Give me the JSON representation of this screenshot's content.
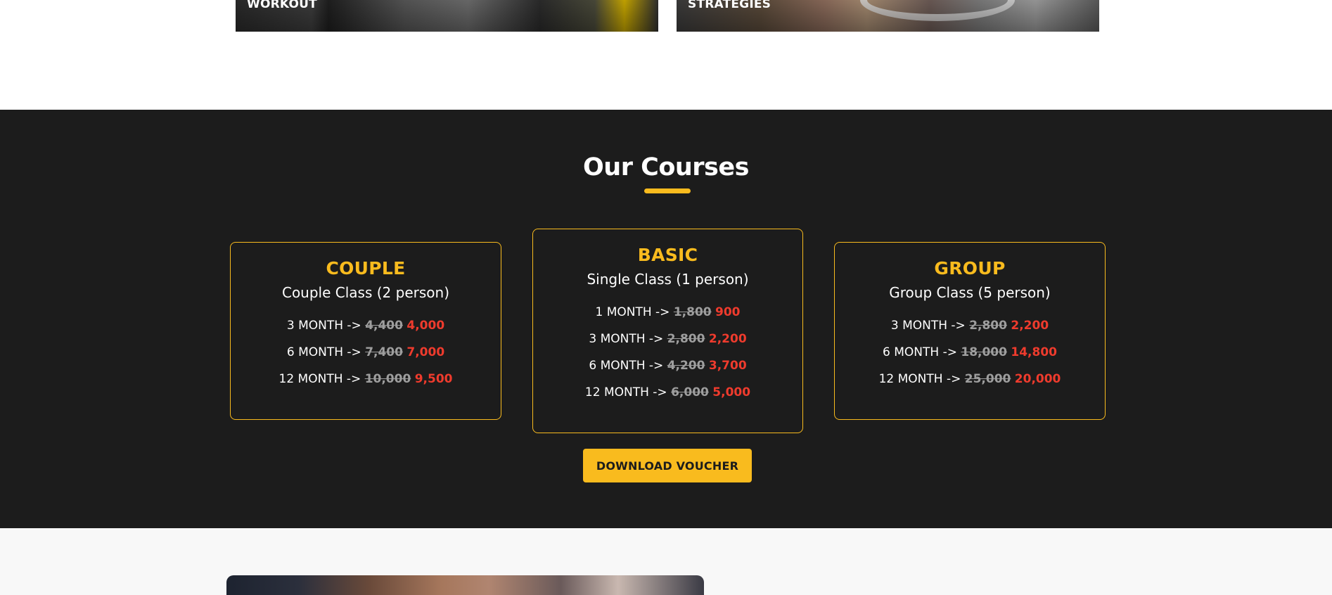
{
  "top_cards": [
    {
      "label": "WORKOUT"
    },
    {
      "label": "STRATEGIES"
    }
  ],
  "courses": {
    "title": "Our Courses",
    "plans": [
      {
        "title": "COUPLE",
        "subtitle": "Couple Class (2 person)",
        "rows": [
          {
            "label": "3 MONTH ->",
            "old": "4,400",
            "new": "4,000"
          },
          {
            "label": "6 MONTH ->",
            "old": "7,400",
            "new": "7,000"
          },
          {
            "label": "12 MONTH ->",
            "old": "10,000",
            "new": "9,500"
          }
        ]
      },
      {
        "title": "BASIC",
        "subtitle": "Single Class (1 person)",
        "rows": [
          {
            "label": "1 MONTH ->",
            "old": "1,800",
            "new": "900"
          },
          {
            "label": "3 MONTH ->",
            "old": "2,800",
            "new": "2,200"
          },
          {
            "label": "6 MONTH ->",
            "old": "4,200",
            "new": "3,700"
          },
          {
            "label": "12 MONTH ->",
            "old": "6,000",
            "new": "5,000"
          }
        ]
      },
      {
        "title": "GROUP",
        "subtitle": "Group Class (5 person)",
        "rows": [
          {
            "label": "3 MONTH ->",
            "old": "2,800",
            "new": "2,200"
          },
          {
            "label": "6 MONTH ->",
            "old": "18,000",
            "new": "14,800"
          },
          {
            "label": "12 MONTH ->",
            "old": "25,000",
            "new": "20,000"
          }
        ]
      }
    ],
    "button_label": "DOWNLOAD VOUCHER"
  },
  "colors": {
    "accent": "#f9bb1e",
    "section_bg": "#1c1c1c",
    "discount": "#ef3b2d",
    "old_price": "#9e9e9e"
  }
}
